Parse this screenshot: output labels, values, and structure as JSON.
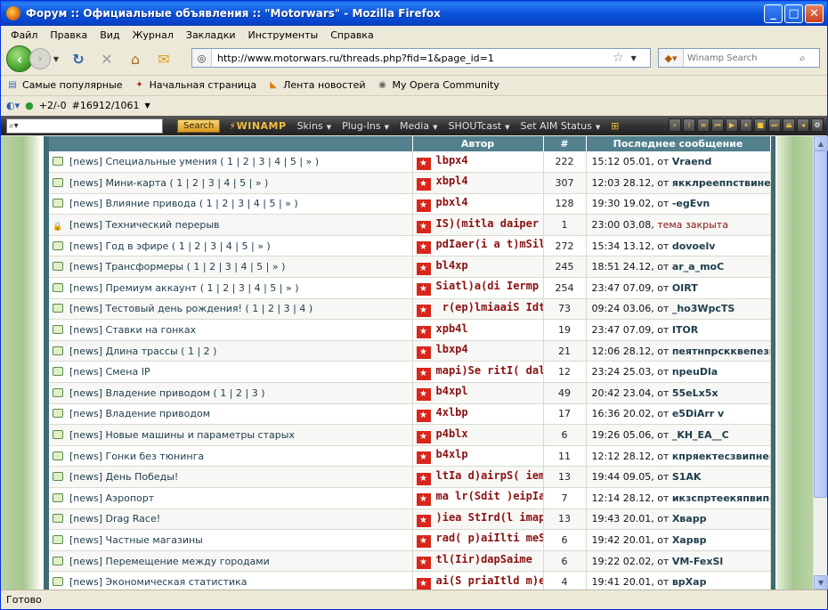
{
  "window": {
    "title": "Форум :: Официальные объявления :: \"Motorwars\" - Mozilla Firefox"
  },
  "menu": [
    "Файл",
    "Правка",
    "Вид",
    "Журнал",
    "Закладки",
    "Инструменты",
    "Справка"
  ],
  "nav": {
    "url": "http://www.motorwars.ru/threads.php?fid=1&page_id=1",
    "search_placeholder": "Winamp Search"
  },
  "bookmarks": [
    "Самые популярные",
    "Начальная страница",
    "Лента новостей",
    "My Opera Community"
  ],
  "toolbar2": {
    "counter": "+2/-0",
    "rank": "#16912/1061"
  },
  "winamp": {
    "search_button": "Search",
    "logo": "WINAMP",
    "menus": [
      "Skins",
      "Plug-Ins",
      "Media",
      "SHOUTcast",
      "Set AIM Status"
    ]
  },
  "table": {
    "headers": {
      "topic": "",
      "author": "Автор",
      "count": "#",
      "last": "Последнее сообщение"
    },
    "rows": [
      {
        "title": "[news] Специальные умения",
        "pages": "( 1 | 2 | 3 | 4 | 5 | » )",
        "author": "lbpx4",
        "count": "222",
        "time": "15:12 05.01,",
        "from": "от",
        "user": "Vraend",
        "locked": false
      },
      {
        "title": "[news] Мини-карта",
        "pages": "( 1 | 2 | 3 | 4 | 5 | » )",
        "author": "xbpl4",
        "count": "307",
        "time": "12:03 28.12,",
        "from": "от",
        "user": "якклреепnствинез",
        "locked": false
      },
      {
        "title": "[news] Влияние привода",
        "pages": "( 1 | 2 | 3 | 4 | 5 | » )",
        "author": "pbxl4",
        "count": "128",
        "time": "19:30 19.02,",
        "from": "от",
        "user": "-egEvn",
        "locked": false
      },
      {
        "title": "[news] Технический перерыв",
        "pages": "",
        "author": "IS)(mitla daiper",
        "count": "1",
        "time": "23:00 03.08,",
        "from": "",
        "user": "тема закрыта",
        "locked": true
      },
      {
        "title": "[news] Год в эфире",
        "pages": "( 1 | 2 | 3 | 4 | 5 | » )",
        "author": "pdIaer(i a t)mSil",
        "count": "272",
        "time": "15:34 13.12,",
        "from": "от",
        "user": "dovoelv",
        "locked": false
      },
      {
        "title": "[news] Трансформеры",
        "pages": "( 1 | 2 | 3 | 4 | 5 | » )",
        "author": "bl4xp",
        "count": "245",
        "time": "18:51 24.12,",
        "from": "от",
        "user": "ar_a_moC",
        "locked": false
      },
      {
        "title": "[news] Премиум аккаунт",
        "pages": "( 1 | 2 | 3 | 4 | 5 | » )",
        "author": "Siatl)a(di Iermp",
        "count": "254",
        "time": "23:47 07.09,",
        "from": "от",
        "user": "OIRT",
        "locked": false
      },
      {
        "title": "[news] Тестовый день рождения!",
        "pages": "( 1 | 2 | 3 | 4 )",
        "author": " r(ep)lmiaaiS Idt",
        "count": "73",
        "time": "09:24 03.06,",
        "from": "от",
        "user": "_ho3WpcTS",
        "locked": false
      },
      {
        "title": "[news] Ставки на гонках",
        "pages": "",
        "author": "xpb4l",
        "count": "19",
        "time": "23:47 07.09,",
        "from": "от",
        "user": "ITOR",
        "locked": false
      },
      {
        "title": "[news] Длина трассы",
        "pages": "( 1 | 2 )",
        "author": "lbxp4",
        "count": "21",
        "time": "12:06 28.12,",
        "from": "от",
        "user": "пеятнпрскквепези",
        "locked": false
      },
      {
        "title": "[news] Смена IP",
        "pages": "",
        "author": "mapi)Se ritI( dal",
        "count": "12",
        "time": "23:24 25.03,",
        "from": "от",
        "user": "npeuDla",
        "locked": false
      },
      {
        "title": "[news] Владение приводом",
        "pages": "( 1 | 2 | 3 )",
        "author": "b4xpl",
        "count": "49",
        "time": "20:42 23.04,",
        "from": "от",
        "user": "55eLx5x",
        "locked": false
      },
      {
        "title": "[news] Владение приводом",
        "pages": "",
        "author": "4xlbp",
        "count": "17",
        "time": "16:36 20.02,",
        "from": "от",
        "user": "e5DiArr v",
        "locked": false
      },
      {
        "title": "[news] Новые машины и параметры старых",
        "pages": "",
        "author": "p4blx",
        "count": "6",
        "time": "19:26 05.06,",
        "from": "от",
        "user": "_KH_EA__C",
        "locked": false
      },
      {
        "title": "[news] Гонки без тюнинга",
        "pages": "",
        "author": "b4xlp",
        "count": "11",
        "time": "12:12 28.12,",
        "from": "от",
        "user": "кпряектесзвипнеп",
        "locked": false
      },
      {
        "title": "[news] День Победы!",
        "pages": "",
        "author": "ltIa d)airpS( iem",
        "count": "13",
        "time": "19:44 09.05,",
        "from": "от",
        "user": "S1AK",
        "locked": false
      },
      {
        "title": "[news] Аэропорт",
        "pages": "",
        "author": "ma lr(Sdit )eipIa",
        "count": "7",
        "time": "12:14 28.12,",
        "from": "от",
        "user": "икзспртеекяпвипе",
        "locked": false
      },
      {
        "title": "[news] Drag Race!",
        "pages": "",
        "author": ")iea StIrd(l imap",
        "count": "13",
        "time": "19:43 20.01,",
        "from": "от",
        "user": "Хварр",
        "locked": false
      },
      {
        "title": "[news] Частные магазины",
        "pages": "",
        "author": "rad( p)aiIlti meS",
        "count": "6",
        "time": "19:42 20.01,",
        "from": "от",
        "user": "Харвр",
        "locked": false
      },
      {
        "title": "[news] Перемещение между городами",
        "pages": "",
        "author": "tl(Iir)dapSaime",
        "count": "6",
        "time": "19:22 02.02,",
        "from": "от",
        "user": "VM-FexSl",
        "locked": false
      },
      {
        "title": "[news] Экономическая статистика",
        "pages": "",
        "author": "ai(S priaItld m)e",
        "count": "4",
        "time": "19:41 20.01,",
        "from": "от",
        "user": "врХар",
        "locked": false
      }
    ]
  },
  "status": {
    "text": "Готово"
  },
  "icons": {
    "back": "back-arrow-icon",
    "forward": "forward-arrow-icon",
    "reload": "reload-icon",
    "stop": "stop-icon",
    "home": "home-icon",
    "bookmark": "star-icon",
    "topic": "topic-bubble-icon",
    "locked": "lock-icon",
    "user": "star-badge-icon"
  }
}
